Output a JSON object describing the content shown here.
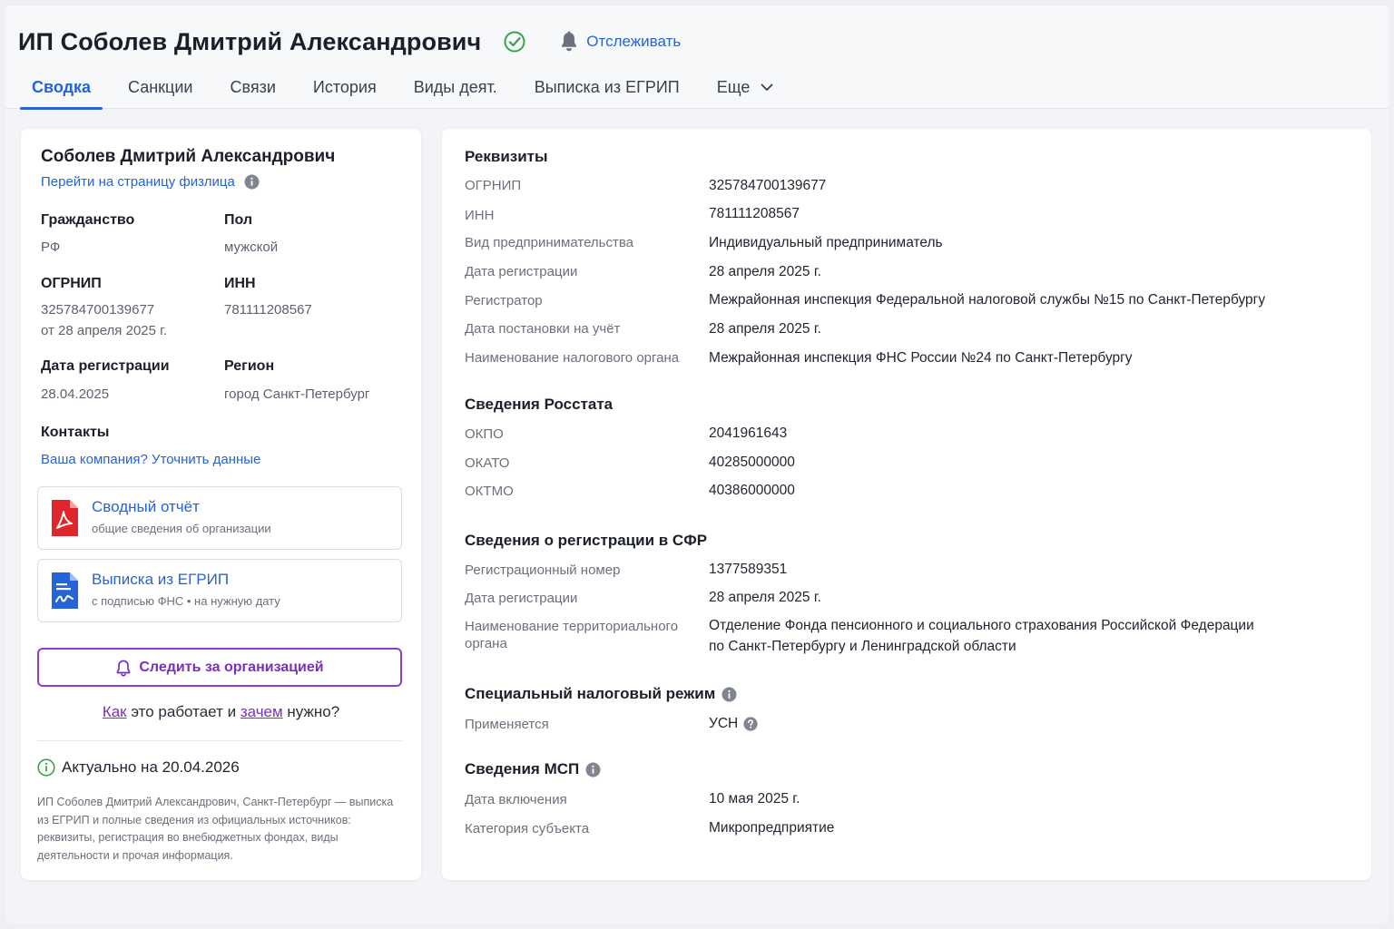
{
  "header": {
    "title": "ИП Соболев Дмитрий Александрович",
    "track_label": "Отслеживать",
    "tabs": [
      {
        "label": "Сводка"
      },
      {
        "label": "Санкции"
      },
      {
        "label": "Связи"
      },
      {
        "label": "История"
      },
      {
        "label": "Виды деят."
      },
      {
        "label": "Выписка из ЕГРИП"
      },
      {
        "label": "Еще"
      }
    ],
    "active_tab": "Сводка",
    "icons": {
      "verified": "check-circle-icon",
      "bell": "bell-icon",
      "more": "chevron-down-icon"
    }
  },
  "left": {
    "person_name": "Соболев Дмитрий Александрович",
    "person_link": "Перейти на страницу физлица",
    "citizenship": {
      "label": "Гражданство",
      "value": "РФ"
    },
    "sex": {
      "label": "Пол",
      "value": "мужской"
    },
    "ogrnip": {
      "label": "ОГРНИП",
      "value": "325784700139677",
      "date": "от 28 апреля 2025 г."
    },
    "inn": {
      "label": "ИНН",
      "value": "781111208567"
    },
    "reg_date": {
      "label": "Дата регистрации",
      "value": "28.04.2025"
    },
    "region": {
      "label": "Регион",
      "value": "город Санкт-Петербург"
    },
    "contacts": {
      "label": "Контакты",
      "link": "Ваша компания? Уточнить данные"
    },
    "docs": [
      {
        "title": "Сводный отчёт",
        "subtitle": "общие сведения об организации",
        "icon": "pdf-icon"
      },
      {
        "title": "Выписка из ЕГРИП",
        "subtitle": "с подписью ФНС • на нужную дату",
        "icon": "signed-doc-icon"
      }
    ],
    "follow_button": "Следить за организацией",
    "how": {
      "how_link": "Как",
      "mid": " это работает и ",
      "why_link": "зачем",
      "end": " нужно?"
    },
    "actual": "Актуально на 20.04.2026",
    "description": "ИП Соболев Дмитрий Александрович, Санкт-Петербург — выписка из ЕГРИП и полные сведения из официальных источников: реквизиты, регистрация во внебюджетных фондах, виды деятельности и прочая информация."
  },
  "right": {
    "requisites": {
      "title": "Реквизиты",
      "rows": [
        {
          "label": "ОГРНИП",
          "value": "325784700139677"
        },
        {
          "label": "ИНН",
          "value": "781111208567"
        },
        {
          "label": "Вид предпринимательства",
          "value": "Индивидуальный предприниматель"
        },
        {
          "label": "Дата регистрации",
          "value": "28 апреля 2025 г."
        },
        {
          "label": "Регистратор",
          "value": "Межрайонная инспекция Федеральной налоговой службы №15 по Санкт-Петербургу"
        },
        {
          "label": "Дата постановки на учёт",
          "value": "28 апреля 2025 г."
        },
        {
          "label": "Наименование налогового органа",
          "value": "Межрайонная инспекция ФНС России №24 по Санкт-Петербургу"
        }
      ]
    },
    "rosstat": {
      "title": "Сведения Росстата",
      "rows": [
        {
          "label": "ОКПО",
          "value": "2041961643"
        },
        {
          "label": "ОКАТО",
          "value": "40285000000"
        },
        {
          "label": "ОКТМО",
          "value": "40386000000"
        }
      ]
    },
    "sfr": {
      "title": "Сведения о регистрации в СФР",
      "rows": [
        {
          "label": "Регистрационный номер",
          "value": "1377589351"
        },
        {
          "label": "Дата регистрации",
          "value": "28 апреля 2025 г."
        }
      ],
      "territorial_label_1": "Наименование территориального",
      "territorial_label_2": "органа",
      "territorial_value_1": "Отделение Фонда пенсионного и социального страхования Российской Федерации",
      "territorial_value_2": "по Санкт-Петербургу и Ленинградской области"
    },
    "tax": {
      "title": "Специальный налоговый режим",
      "label": "Применяется",
      "value": "УСН"
    },
    "msp": {
      "title": "Сведения МСП",
      "rows": [
        {
          "label": "Дата включения",
          "value": "10 мая 2025 г."
        },
        {
          "label": "Категория субъекта",
          "value": "Микропредприятие"
        }
      ]
    }
  },
  "colors": {
    "accent": "#2563d6",
    "follow": "#7a2fc0",
    "verified": "#3aa24a",
    "pdf": "#e0262a"
  }
}
